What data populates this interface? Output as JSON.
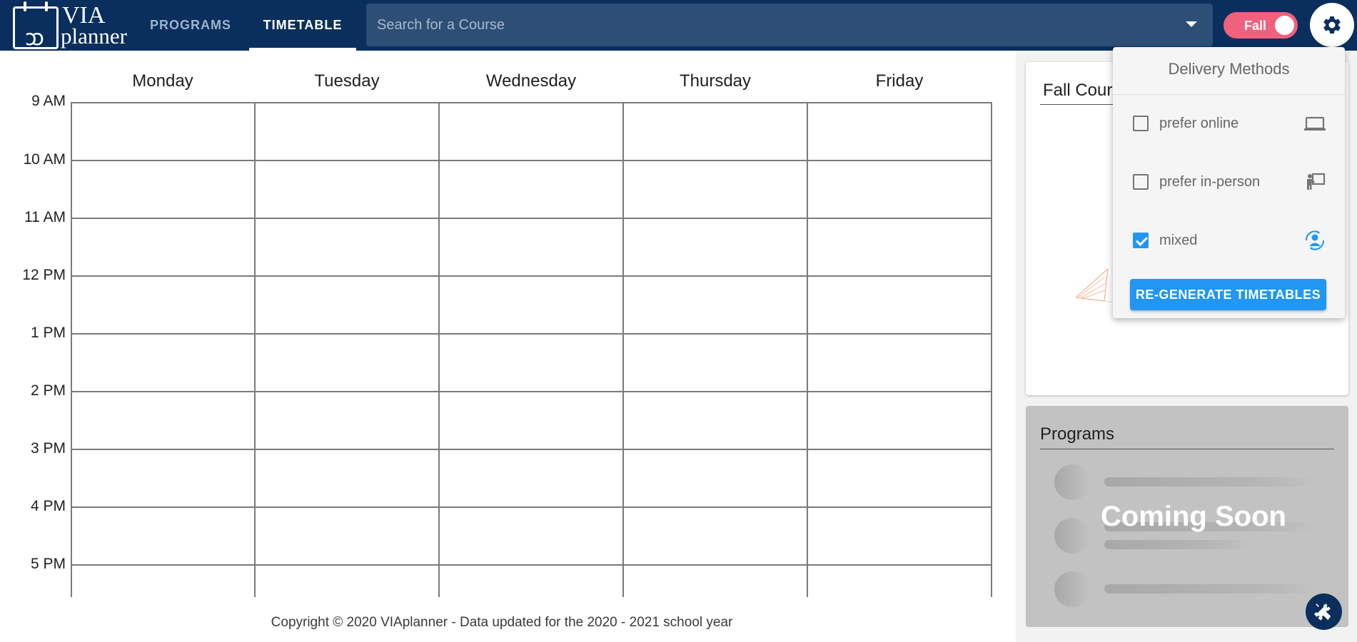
{
  "header": {
    "logo_top": "VIA",
    "logo_bottom": "planner",
    "tabs": [
      {
        "label": "PROGRAMS",
        "active": false
      },
      {
        "label": "TIMETABLE",
        "active": true
      }
    ],
    "search": {
      "placeholder": "Search for a Course",
      "value": ""
    },
    "term_toggle": {
      "label": "Fall",
      "on": true,
      "color": "#f0617e"
    },
    "settings_icon": "gear-icon",
    "bar_color": "#0a2f5c"
  },
  "timetable": {
    "days": [
      "Monday",
      "Tuesday",
      "Wednesday",
      "Thursday",
      "Friday"
    ],
    "times": [
      "9 AM",
      "10 AM",
      "11 AM",
      "12 PM",
      "1 PM",
      "2 PM",
      "3 PM",
      "4 PM",
      "5 PM"
    ]
  },
  "footer": {
    "copyright": "Copyright © 2020 VIAplanner - Data updated for the 2020 - 2021 school year"
  },
  "fall_courses": {
    "title": "Fall Cour"
  },
  "programs": {
    "title": "Programs",
    "overlay": "Coming Soon"
  },
  "delivery_menu": {
    "title": "Delivery Methods",
    "options": [
      {
        "label": "prefer online",
        "checked": false,
        "icon": "laptop-icon"
      },
      {
        "label": "prefer in-person",
        "checked": false,
        "icon": "presenter-icon"
      },
      {
        "label": "mixed",
        "checked": true,
        "icon": "mixed-person-icon"
      }
    ],
    "button": "RE-GENERATE TIMETABLES",
    "accent": "#2196f3"
  },
  "fab_icon": "tools-icon"
}
